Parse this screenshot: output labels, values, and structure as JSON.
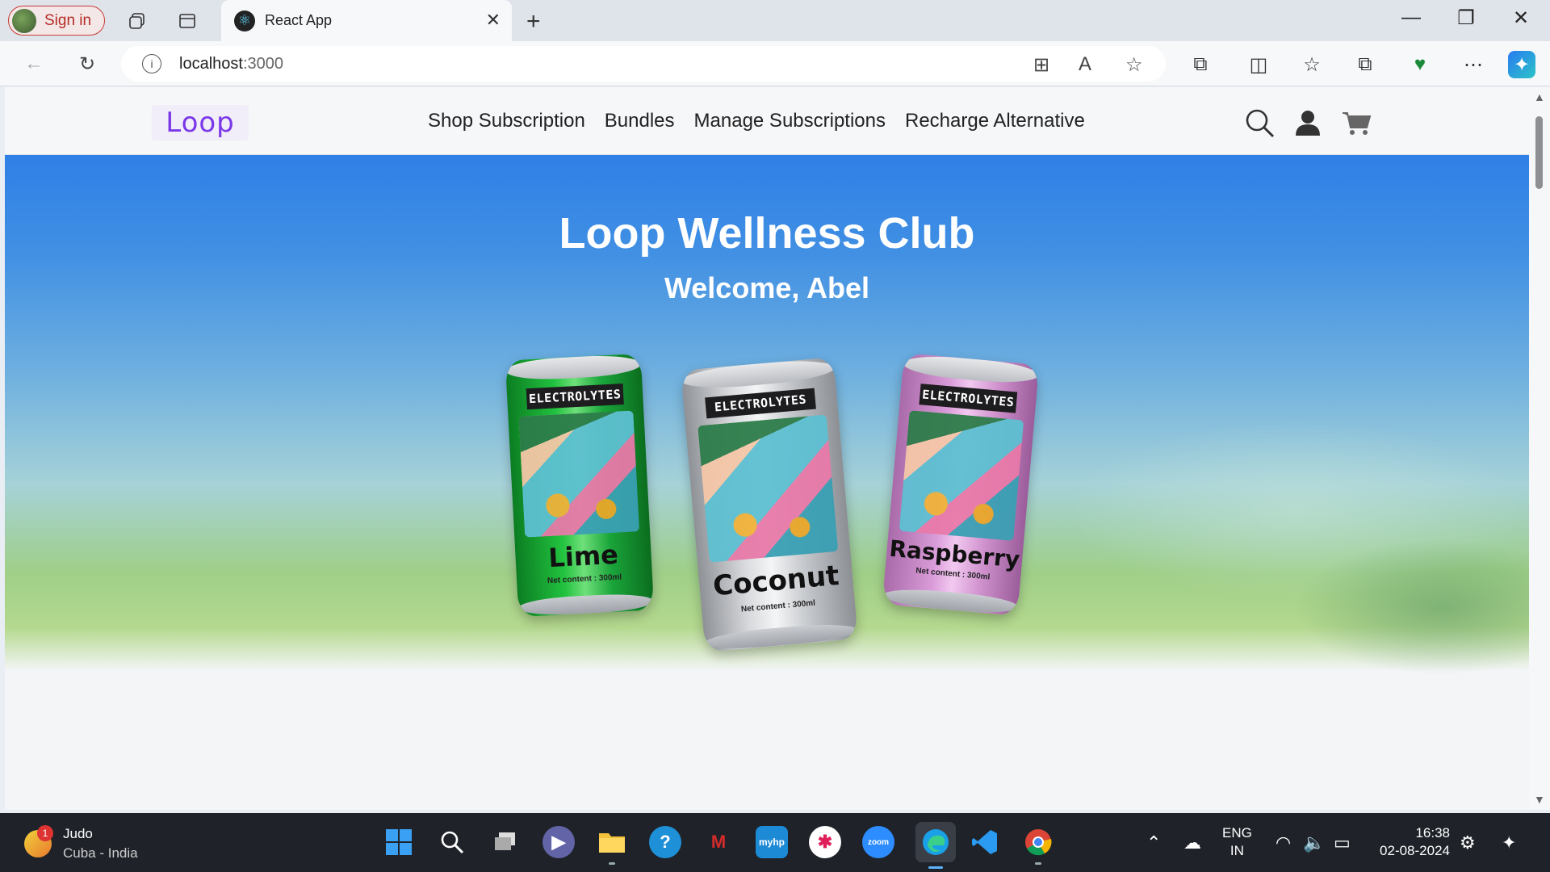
{
  "browser": {
    "profile_label": "Sign in",
    "tab_title": "React App",
    "tab_favicon": "react-logo-icon",
    "url_host": "localhost",
    "url_port": ":3000",
    "new_tab_symbol": "+",
    "close_tab_symbol": "✕"
  },
  "header": {
    "logo_text": "Loop",
    "nav": [
      "Shop Subscription",
      "Bundles",
      "Manage Subscriptions",
      "Recharge Alternative"
    ],
    "icons": [
      "search-icon",
      "user-icon",
      "cart-icon"
    ]
  },
  "hero": {
    "title": "Loop Wellness Club",
    "subtitle": "Welcome, Abel",
    "cans": [
      {
        "band": "ELECTROLYTES",
        "name": "Lime",
        "net": "Net content : 300ml",
        "color": "#1aa53a"
      },
      {
        "band": "ELECTROLYTES",
        "name": "Coconut",
        "net": "Net content : 300ml",
        "color": "#c9cbcf"
      },
      {
        "band": "ELECTROLYTES",
        "name": "Raspberry",
        "net": "Net content : 300ml",
        "color": "#d99ad8"
      }
    ]
  },
  "taskbar": {
    "weather_title": "Judo",
    "weather_sub": "Cuba - India",
    "weather_badge": "1",
    "apps": [
      "windows-start-icon",
      "search-icon",
      "task-view-icon",
      "teams-chat-icon",
      "file-explorer-icon",
      "get-help-icon",
      "mcafee-icon",
      "myhp-icon",
      "slack-icon",
      "zoom-icon",
      "edge-icon",
      "vscode-icon",
      "chrome-icon"
    ],
    "lang_top": "ENG",
    "lang_bottom": "IN",
    "time": "16:38",
    "date": "02-08-2024"
  },
  "colors": {
    "accent_purple": "#7a38e8",
    "sign_in_red": "#b42c25"
  }
}
